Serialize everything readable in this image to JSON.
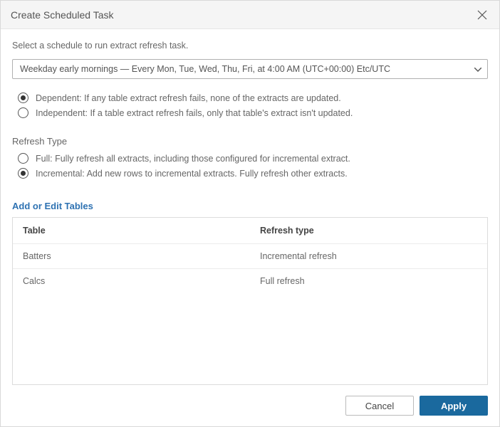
{
  "dialog": {
    "title": "Create Scheduled Task",
    "instructions": "Select a schedule to run extract refresh task.",
    "schedule_selected": "Weekday early mornings — Every Mon, Tue, Wed, Thu, Fri, at 4:00 AM (UTC+00:00) Etc/UTC"
  },
  "dependency": {
    "options": [
      {
        "label": "Dependent: If any table extract refresh fails, none of the extracts are updated.",
        "selected": true
      },
      {
        "label": "Independent: If a table extract refresh fails, only that table's extract isn't updated.",
        "selected": false
      }
    ]
  },
  "refresh_type": {
    "heading": "Refresh Type",
    "options": [
      {
        "label": "Full: Fully refresh all extracts, including those configured for incremental extract.",
        "selected": false
      },
      {
        "label": "Incremental: Add new rows to incremental extracts. Fully refresh other extracts.",
        "selected": true
      }
    ]
  },
  "add_link": "Add or Edit Tables",
  "tables": {
    "header": {
      "col0": "Table",
      "col1": "Refresh type"
    },
    "rows": [
      {
        "col0": "Batters",
        "col1": "Incremental refresh"
      },
      {
        "col0": "Calcs",
        "col1": "Full refresh"
      }
    ]
  },
  "buttons": {
    "cancel": "Cancel",
    "apply": "Apply"
  }
}
